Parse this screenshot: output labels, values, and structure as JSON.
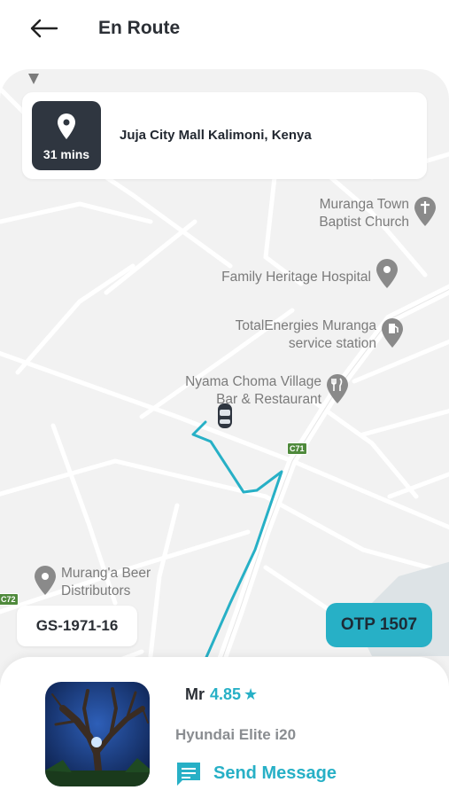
{
  "header": {
    "title": "En Route"
  },
  "destination": {
    "eta": "31 mins",
    "name": "Juja City Mall Kalimoni, Kenya"
  },
  "map": {
    "pois": [
      {
        "id": "church",
        "line1": "Muranga Town",
        "line2": "Baptist Church"
      },
      {
        "id": "hospital",
        "line1": "Family Heritage Hospital"
      },
      {
        "id": "fuel",
        "line1": "TotalEnergies Muranga",
        "line2": "service station"
      },
      {
        "id": "restaurant",
        "line1": "Nyama Choma Village",
        "line2": "Bar & Restaurant"
      },
      {
        "id": "beer",
        "line1": "Murang'a Beer",
        "line2": "Distributors"
      }
    ],
    "road_c71": "C71",
    "road_c72": "C72",
    "route_color": "#27b0c6"
  },
  "vehicle": {
    "plate": "GS-1971-16"
  },
  "otp": {
    "label": "OTP 1507"
  },
  "driver": {
    "title": "Mr",
    "rating": "4.85",
    "star": "★",
    "car": "Hyundai Elite i20",
    "send_message": "Send Message"
  },
  "colors": {
    "accent": "#27b0c6",
    "dark": "#2f3640",
    "map_bg": "#f2f2f2"
  }
}
